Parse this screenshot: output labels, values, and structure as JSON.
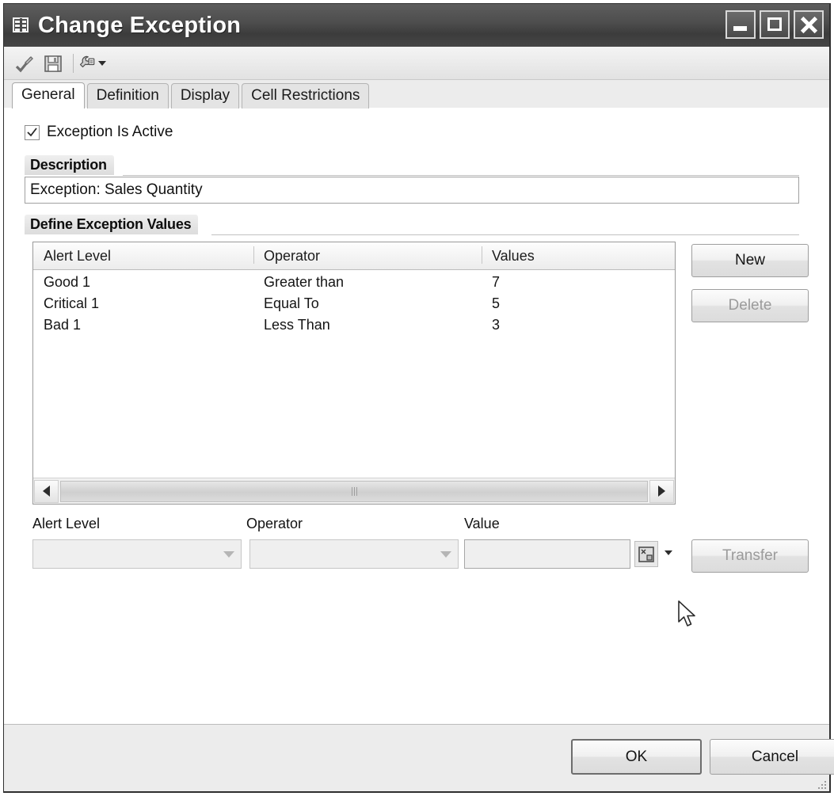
{
  "window": {
    "title": "Change Exception",
    "icon": "table-grid-icon",
    "controls": {
      "minimize": "minimize-button",
      "maximize": "maximize-button",
      "close": "close-button"
    }
  },
  "toolbar": {
    "items": [
      {
        "name": "check-edit-icon",
        "label": ""
      },
      {
        "name": "save-icon",
        "label": ""
      },
      {
        "name": "tools-wrench-icon",
        "label": "",
        "has_dropdown": true
      }
    ]
  },
  "tabs": [
    {
      "label": "General",
      "active": true
    },
    {
      "label": "Definition",
      "active": false
    },
    {
      "label": "Display",
      "active": false
    },
    {
      "label": "Cell Restrictions",
      "active": false
    }
  ],
  "general": {
    "active_checkbox": {
      "label": "Exception Is Active",
      "checked": true
    },
    "description": {
      "group_label": "Description",
      "value": "Exception: Sales Quantity",
      "placeholder": ""
    },
    "define_values": {
      "group_label": "Define Exception Values",
      "columns": [
        "Alert Level",
        "Operator",
        "Values"
      ],
      "rows": [
        {
          "alert_level": "Good 1",
          "operator": "Greater than",
          "value": "7"
        },
        {
          "alert_level": "Critical 1",
          "operator": "Equal To",
          "value": "5"
        },
        {
          "alert_level": "Bad 1",
          "operator": "Less Than",
          "value": "3"
        }
      ],
      "buttons": {
        "new": "New",
        "delete": "Delete"
      }
    },
    "entry_form": {
      "alert_level_label": "Alert Level",
      "operator_label": "Operator",
      "value_label": "Value",
      "alert_level_value": "",
      "operator_value": "",
      "value_value": "",
      "value_help_icon": "value-help-icon",
      "transfer_button": "Transfer"
    }
  },
  "footer": {
    "ok": "OK",
    "cancel": "Cancel"
  },
  "colors": {
    "titlebar": "#4e4e4e",
    "window_bg": "#ececec",
    "content_bg": "#ffffff",
    "text": "#111111",
    "disabled_text": "#9b9b9b"
  }
}
